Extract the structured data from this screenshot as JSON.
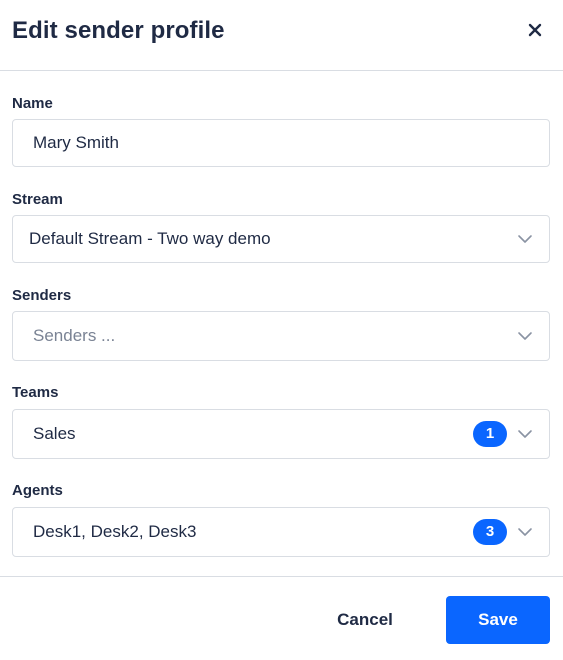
{
  "dialog": {
    "title": "Edit sender profile"
  },
  "fields": {
    "name": {
      "label": "Name",
      "value": "Mary Smith"
    },
    "stream": {
      "label": "Stream",
      "value": "Default Stream - Two way demo"
    },
    "senders": {
      "label": "Senders",
      "placeholder": "Senders ..."
    },
    "teams": {
      "label": "Teams",
      "value": "Sales",
      "count": "1"
    },
    "agents": {
      "label": "Agents",
      "value": "Desk1, Desk2, Desk3",
      "count": "3"
    }
  },
  "footer": {
    "cancel_label": "Cancel",
    "save_label": "Save"
  },
  "icons": {
    "close": "close-icon",
    "chevron": "chevron-down-icon"
  },
  "colors": {
    "primary": "#0a66ff",
    "text": "#1f2a44",
    "placeholder": "#7a8394",
    "border": "#d9dde3"
  }
}
